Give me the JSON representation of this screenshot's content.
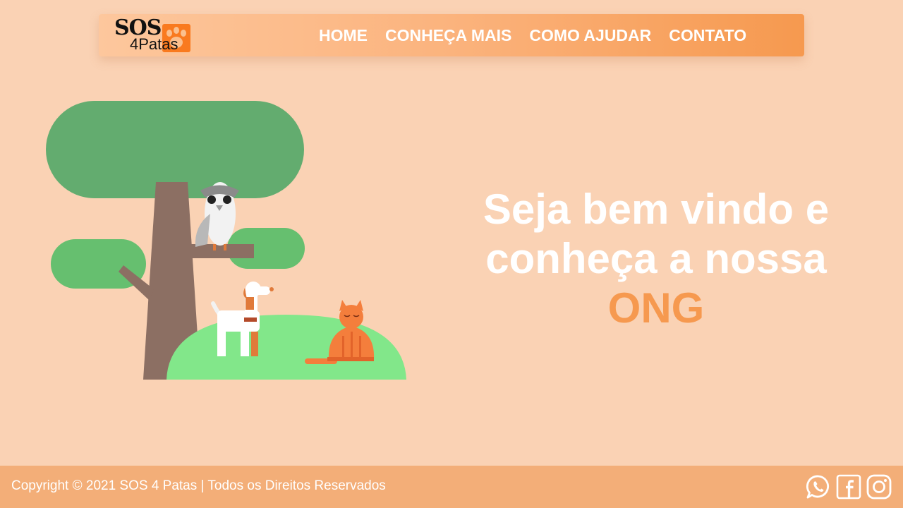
{
  "brand": {
    "logo_top": "SOS",
    "logo_bottom": "4Patas",
    "logo_accent": "#f97a1f"
  },
  "nav": {
    "items": [
      {
        "label": "HOME"
      },
      {
        "label": "CONHEÇA MAIS"
      },
      {
        "label": "COMO AJUDAR"
      },
      {
        "label": "CONTATO"
      }
    ]
  },
  "hero": {
    "line1": "Seja bem vindo e",
    "line2": "conheça a nossa",
    "highlight": "ONG",
    "highlight_color": "#f6994f"
  },
  "footer": {
    "copyright": "Copyright © 2021 SOS 4 Patas  |  Todos os Direitos Reservados",
    "social": [
      {
        "icon": "whatsapp-icon"
      },
      {
        "icon": "facebook-icon"
      },
      {
        "icon": "instagram-icon"
      }
    ]
  },
  "colors": {
    "background": "#fad2b4",
    "nav_gradient_start": "#fdc79d",
    "nav_gradient_end": "#f6994f",
    "footer": "#f3ae78",
    "tree_leaves": "#63ac6f",
    "tree_trunk": "#8c6f63",
    "grass": "#82e78a",
    "cat": "#f47e3c"
  }
}
